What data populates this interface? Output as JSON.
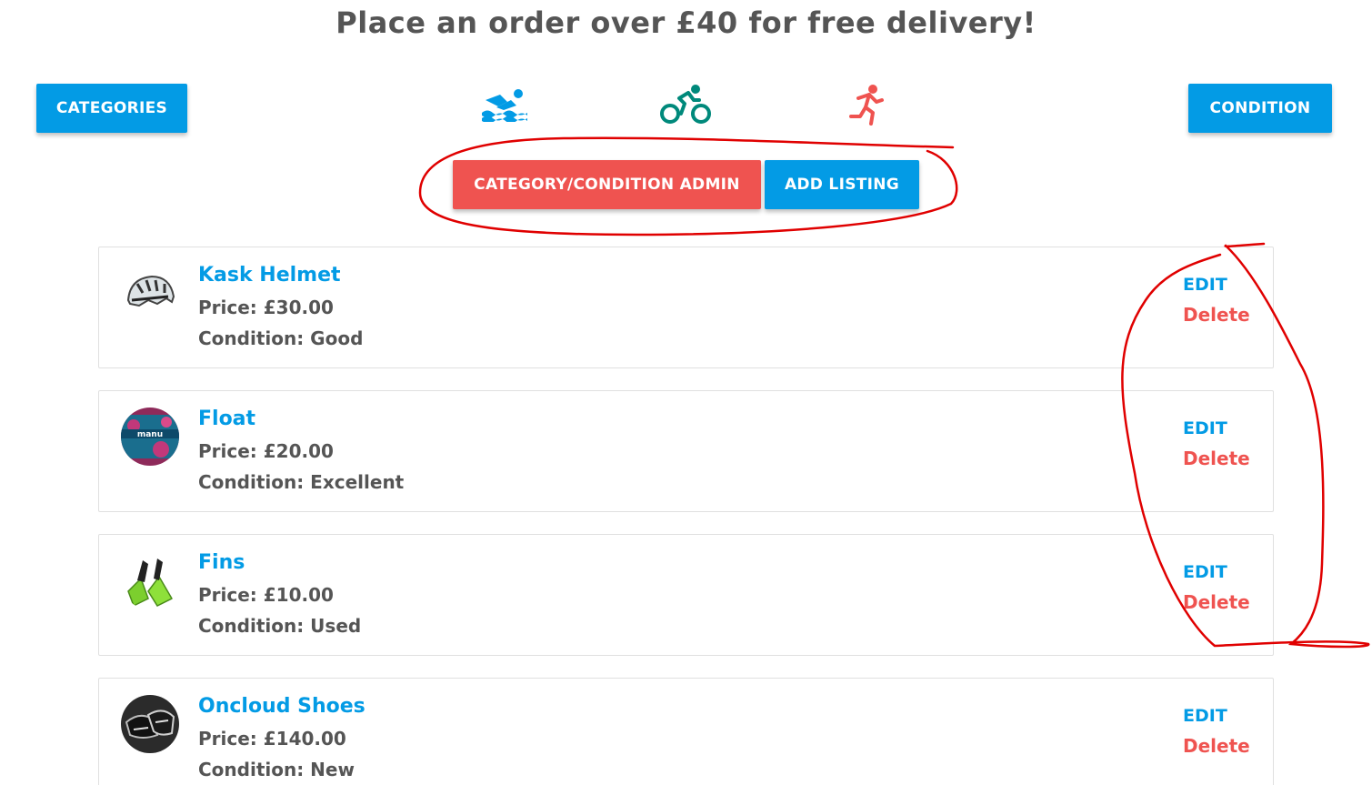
{
  "banner": {
    "text": "Place an order over £40 for free delivery!"
  },
  "toolbar": {
    "categories_label": "Categories",
    "condition_label": "Condition",
    "admin_label": "Category/Condition Admin",
    "add_listing_label": "Add Listing"
  },
  "sport_icons": [
    {
      "name": "swimming-icon",
      "color": "#039be5"
    },
    {
      "name": "cycling-icon",
      "color": "#00897b"
    },
    {
      "name": "running-icon",
      "color": "#ef5350"
    }
  ],
  "listings": [
    {
      "title": "Kask Helmet",
      "price": "Price: £30.00",
      "condition": "Condition: Good",
      "edit": "Edit",
      "delete": "Delete"
    },
    {
      "title": "Float",
      "price": "Price: £20.00",
      "condition": "Condition: Excellent",
      "edit": "Edit",
      "delete": "Delete"
    },
    {
      "title": "Fins",
      "price": "Price: £10.00",
      "condition": "Condition: Used",
      "edit": "Edit",
      "delete": "Delete"
    },
    {
      "title": "Oncloud Shoes",
      "price": "Price: £140.00",
      "condition": "Condition: New",
      "edit": "Edit",
      "delete": "Delete"
    }
  ],
  "colors": {
    "primary": "#039be5",
    "danger": "#ef5350",
    "text": "#555555",
    "annotation": "#e00000"
  }
}
